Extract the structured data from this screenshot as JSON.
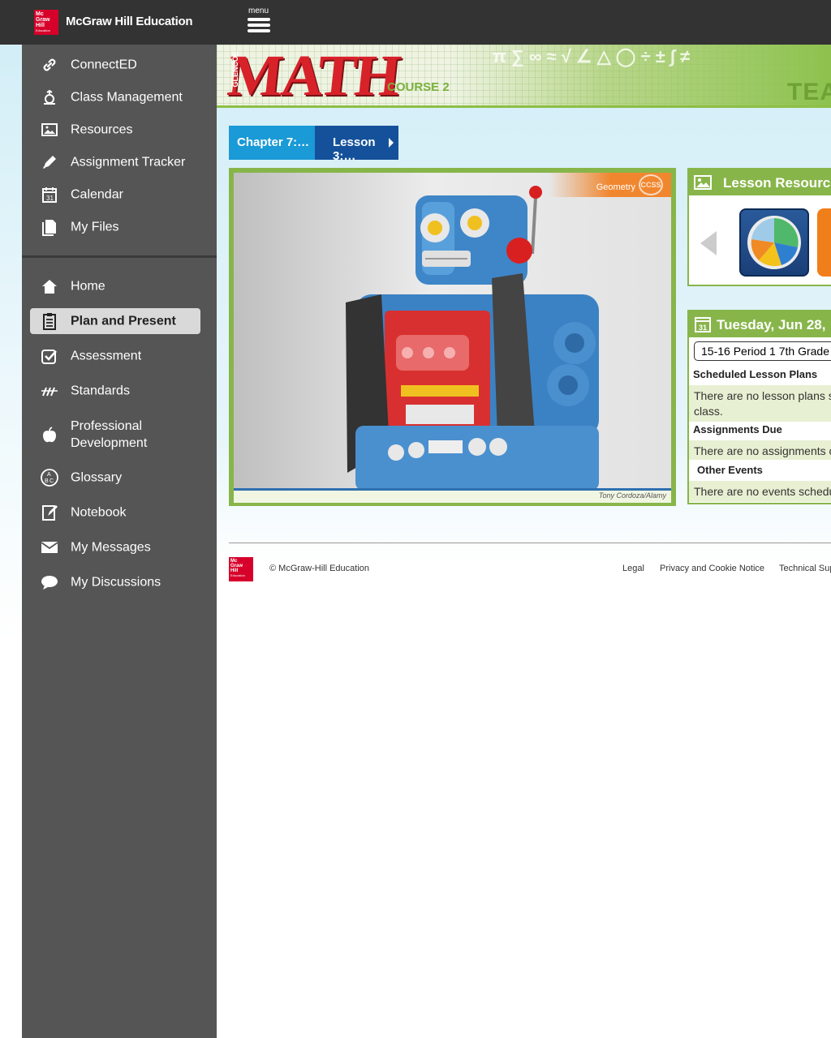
{
  "header": {
    "logo_text": "Mc Graw Hill Education",
    "brand": "McGraw Hill Education",
    "menu_label": "menu"
  },
  "sidebar": {
    "top_items": [
      {
        "label": "ConnectED",
        "icon": "link-icon"
      },
      {
        "label": "Class Management",
        "icon": "apple-hand-icon"
      },
      {
        "label": "Resources",
        "icon": "image-icon"
      },
      {
        "label": "Assignment Tracker",
        "icon": "pencil-icon"
      },
      {
        "label": "Calendar",
        "icon": "calendar-icon"
      },
      {
        "label": "My Files",
        "icon": "files-icon"
      }
    ],
    "bottom_items": [
      {
        "label": "Home",
        "icon": "home-icon"
      },
      {
        "label": "Plan and Present",
        "icon": "clipboard-icon",
        "active": true
      },
      {
        "label": "Assessment",
        "icon": "checkbox-icon"
      },
      {
        "label": "Standards",
        "icon": "slashes-icon"
      },
      {
        "label": "Professional Development",
        "icon": "apple-icon"
      },
      {
        "label": "Glossary",
        "icon": "abc-icon"
      },
      {
        "label": "Notebook",
        "icon": "notebook-icon"
      },
      {
        "label": "My Messages",
        "icon": "envelope-icon"
      },
      {
        "label": "My Discussions",
        "icon": "speech-bubble-icon"
      }
    ],
    "colors": {
      "bg": "#555555",
      "active_bg": "#d9d9d9"
    }
  },
  "banner": {
    "series": "GLENCOE",
    "title": "MATH",
    "course": "COURSE 2",
    "edition": "TEA"
  },
  "breadcrumb": {
    "chapter": "Chapter 7:…",
    "lesson": "Lesson 3:…"
  },
  "hero": {
    "tag": "Geometry",
    "badge": "CCSS",
    "credit": "Tony Cordoza/Alamy"
  },
  "lesson_resources": {
    "title": "Lesson Resources"
  },
  "calendar": {
    "date": "Tuesday, Jun 28,",
    "class_select": "15-16 Period 1 7th Grade",
    "sections": [
      {
        "label": "Scheduled Lesson Plans",
        "note": "There are no lesson plans s class."
      },
      {
        "label": "Assignments Due",
        "note": "There are no assignments c"
      },
      {
        "label": "Other Events",
        "note": "There are no events schedu"
      }
    ]
  },
  "footer": {
    "logo_text": "Mc Graw Hill Education",
    "copyright": "© McGraw-Hill Education",
    "links": [
      "Legal",
      "Privacy and Cookie Notice",
      "Technical Sup"
    ]
  },
  "colors": {
    "topbar": "#333333",
    "accent_green": "#88b54a",
    "crumb_light": "#1a9ad6",
    "crumb_dark": "#14519a",
    "brand_red": "#d6002a"
  }
}
